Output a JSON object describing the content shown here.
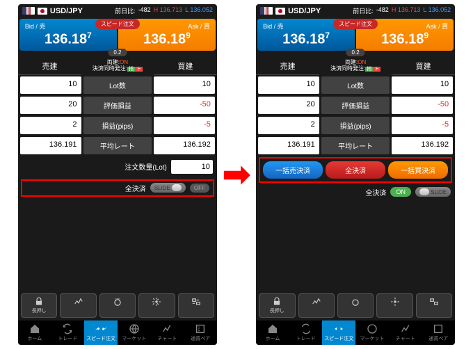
{
  "pair": "USD/JPY",
  "prev_label": "前日比:",
  "prev": "-482",
  "high_prefix": "H",
  "high": "136.713",
  "low_prefix": "L",
  "low": "136.052",
  "bid_label": "Bid / 売",
  "ask_label": "Ask / 買",
  "bid_int": "136.",
  "bid_big": "18",
  "bid_pip": "7",
  "ask_int": "136.",
  "ask_big": "18",
  "ask_pip": "9",
  "speed_badge": "スピード注文",
  "spread": "0.2",
  "sell_hdr": "売建",
  "buy_hdr": "買建",
  "ryoken_label": "両建:",
  "ryoken_val": "ON",
  "doji_label": "決済同時発注:",
  "badge1": "指",
  "badge2": "ト",
  "rows": [
    {
      "l": "10",
      "m": "Lot数",
      "r": "10",
      "rneg": false
    },
    {
      "l": "20",
      "m": "評価損益",
      "r": "-50",
      "rneg": true
    },
    {
      "l": "2",
      "m": "損益(pips)",
      "r": "-5",
      "rneg": true
    },
    {
      "l": "136.191",
      "m": "平均レート",
      "r": "136.192",
      "rneg": false
    }
  ],
  "lot_label": "注文数量(Lot)",
  "lot_val": "10",
  "settle_label": "全決済",
  "slide_text": "SLIDE",
  "off_text": "OFF",
  "on_text": "ON",
  "btn_sell_all": "一括売決済",
  "btn_all": "全決済",
  "btn_buy_all": "一括買決済",
  "toolbar": [
    "長押し",
    "",
    "",
    "",
    ""
  ],
  "nav": [
    "ホーム",
    "トレード",
    "スピード注文",
    "マーケット",
    "チャート",
    "通貨ペア"
  ]
}
